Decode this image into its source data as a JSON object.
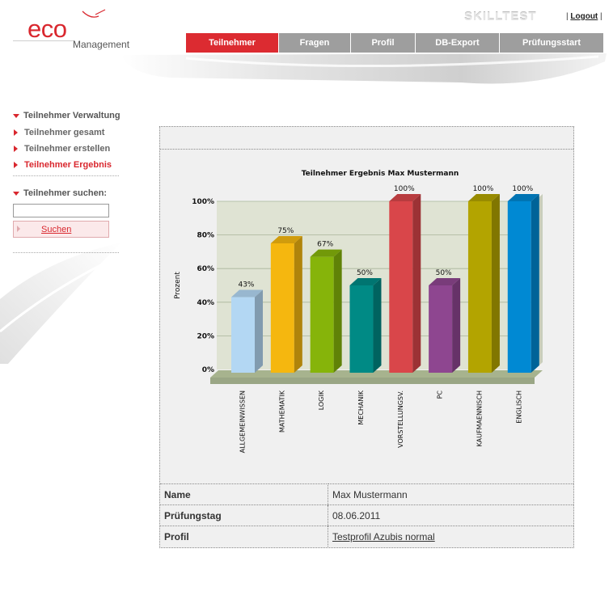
{
  "header": {
    "logo_main": "eco",
    "logo_sub": "Management",
    "brand": "SKILLTEST",
    "logout_label": "Logout"
  },
  "nav": {
    "tabs": [
      {
        "label": "Teilnehmer",
        "active": true
      },
      {
        "label": "Fragen",
        "active": false
      },
      {
        "label": "Profil",
        "active": false
      },
      {
        "label": "DB-Export",
        "active": false
      },
      {
        "label": "Prüfungsstart",
        "active": false
      }
    ]
  },
  "sidebar": {
    "section_title": "Teilnehmer Verwaltung",
    "items": [
      {
        "label": "Teilnehmer gesamt",
        "active": false
      },
      {
        "label": "Teilnehmer erstellen",
        "active": false
      },
      {
        "label": "Teilnehmer Ergebnis",
        "active": true
      }
    ],
    "search_title": "Teilnehmer suchen:",
    "search_value": "",
    "search_button": "Suchen"
  },
  "chart_data": {
    "type": "bar",
    "title": "Teilnehmer Ergebnis Max Mustermann",
    "ylabel": "Prozent",
    "xlabel": "",
    "ylim": [
      0,
      100
    ],
    "yticks": [
      "0%",
      "20%",
      "40%",
      "60%",
      "80%",
      "100%"
    ],
    "categories": [
      "ALLGEMEINWISSEN",
      "MATHEMATIK",
      "LOGIK",
      "MECHANIK",
      "VORSTELLUNGSV.",
      "PC",
      "KAUFMAENNISCH",
      "ENGLISCH"
    ],
    "values": [
      43,
      75,
      67,
      50,
      100,
      50,
      100,
      100
    ],
    "value_labels": [
      "43%",
      "75%",
      "67%",
      "50%",
      "100%",
      "50%",
      "100%",
      "100%"
    ],
    "colors": [
      "#b3d7f3",
      "#f5b70f",
      "#86b40a",
      "#008a85",
      "#d9464a",
      "#8e4690",
      "#b3a400",
      "#0089d3"
    ],
    "grid": true
  },
  "info": {
    "rows": [
      {
        "key": "Name",
        "value": "Max Mustermann",
        "link": false
      },
      {
        "key": "Prüfungstag",
        "value": "08.06.2011",
        "link": false
      },
      {
        "key": "Profil",
        "value": "Testprofil Azubis normal",
        "link": true
      }
    ]
  }
}
